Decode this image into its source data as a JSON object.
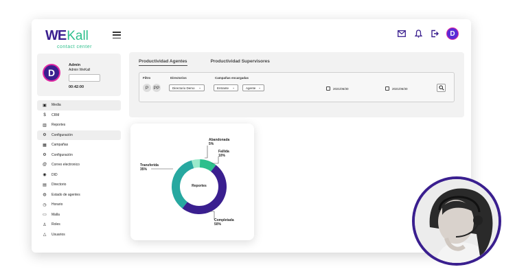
{
  "brand": {
    "we": "WE",
    "kall": "Kall",
    "sub": "contact center"
  },
  "header": {
    "avatar_initial": "D"
  },
  "profile": {
    "initial": "D",
    "name": "Admin",
    "role": "Admin WeKall",
    "time": "00:42:00"
  },
  "nav": [
    {
      "label": "Media",
      "icon": "media-icon",
      "active": true
    },
    {
      "label": "CRM",
      "icon": "dollar-icon",
      "active": false
    },
    {
      "label": "Reportes",
      "icon": "chart-icon",
      "active": false
    },
    {
      "label": "Configuración",
      "icon": "gear-icon",
      "active": true
    },
    {
      "label": "Campañas",
      "icon": "grid-icon",
      "active": false
    },
    {
      "label": "Configuración",
      "icon": "gear-icon",
      "active": false
    },
    {
      "label": "Correo electronico",
      "icon": "at-icon",
      "active": false
    },
    {
      "label": "DID",
      "icon": "circle-icon",
      "active": false
    },
    {
      "label": "Directorio",
      "icon": "book-icon",
      "active": false
    },
    {
      "label": "Estado de agentes",
      "icon": "status-icon",
      "active": false
    },
    {
      "label": "Horario",
      "icon": "clock-icon",
      "active": false
    },
    {
      "label": "Malla",
      "icon": "calendar-icon",
      "active": false
    },
    {
      "label": "Roles",
      "icon": "roles-icon",
      "active": false
    },
    {
      "label": "Usuarios",
      "icon": "users-icon",
      "active": false
    }
  ],
  "tabs": [
    "Productividad Agentes",
    "Productividad Supervisores"
  ],
  "filters": {
    "filtro_label": "Filtro",
    "chips": [
      "P",
      "PP"
    ],
    "directorios_label": "Directorios",
    "directorios_value": "Directorio Demo",
    "campanas_label": "Campañas encargadas",
    "campanas_value": "Entrante",
    "agente_value": "Agente",
    "date_from": "2021/06/30",
    "date_to": "2021/06/30"
  },
  "chart_data": {
    "type": "pie",
    "center_label": "Reportes",
    "slices": [
      {
        "label": "Completada",
        "value": 50,
        "pct_text": "50%",
        "color": "#3a1f8f"
      },
      {
        "label": "Fallida",
        "value": 10,
        "pct_text": "10%",
        "color": "#2dbf8c"
      },
      {
        "label": "Abandonada",
        "value": 5,
        "pct_text": "5%",
        "color": "#9aeacb"
      },
      {
        "label": "Transferida",
        "value": 35,
        "pct_text": "35%",
        "color": "#27a8a0"
      }
    ]
  }
}
